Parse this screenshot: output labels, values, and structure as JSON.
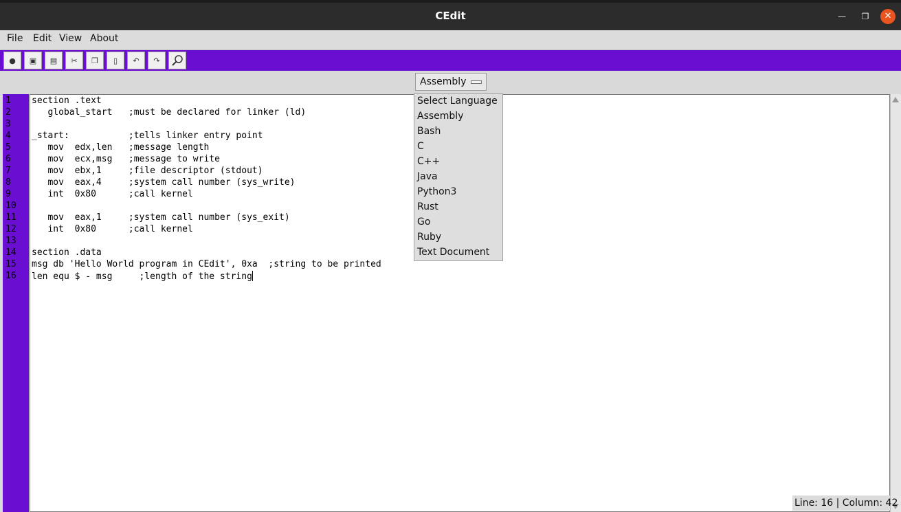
{
  "window": {
    "title": "CEdit"
  },
  "window_controls": [
    "minimize-icon",
    "maximize-icon",
    "close-icon"
  ],
  "menu": {
    "items": [
      "File",
      "Edit",
      "View",
      "About"
    ]
  },
  "toolbar": {
    "buttons": [
      "new-icon",
      "open-icon",
      "save-icon",
      "cut-icon",
      "copy-icon",
      "paste-icon",
      "undo-icon",
      "redo-icon",
      "search-icon"
    ]
  },
  "language_select": {
    "selected": "Assembly",
    "options": [
      "Select Language",
      "Assembly",
      "Bash",
      "C",
      "C++",
      "Java",
      "Python3",
      "Rust",
      "Go",
      "Ruby",
      "Text Document"
    ]
  },
  "editor": {
    "line_numbers": [
      "1",
      "2",
      "3",
      "4",
      "5",
      "6",
      "7",
      "8",
      "9",
      "10",
      "11",
      "12",
      "13",
      "14",
      "15",
      "16"
    ],
    "lines": [
      "section .text",
      "   global_start   ;must be declared for linker (ld)",
      "",
      "_start:           ;tells linker entry point",
      "   mov  edx,len   ;message length",
      "   mov  ecx,msg   ;message to write",
      "   mov  ebx,1     ;file descriptor (stdout)",
      "   mov  eax,4     ;system call number (sys_write)",
      "   int  0x80      ;call kernel",
      "",
      "   mov  eax,1     ;system call number (sys_exit)",
      "   int  0x80      ;call kernel",
      "",
      "section .data",
      "msg db 'Hello World program in CEdit', 0xa  ;string to be printed",
      "len equ $ - msg     ;length of the string"
    ]
  },
  "status": {
    "text": "Line: 16 | Column: 42"
  },
  "colors": {
    "accent": "#6a0fd1",
    "titlebar": "#2c2c2c",
    "close_button": "#e95420"
  }
}
